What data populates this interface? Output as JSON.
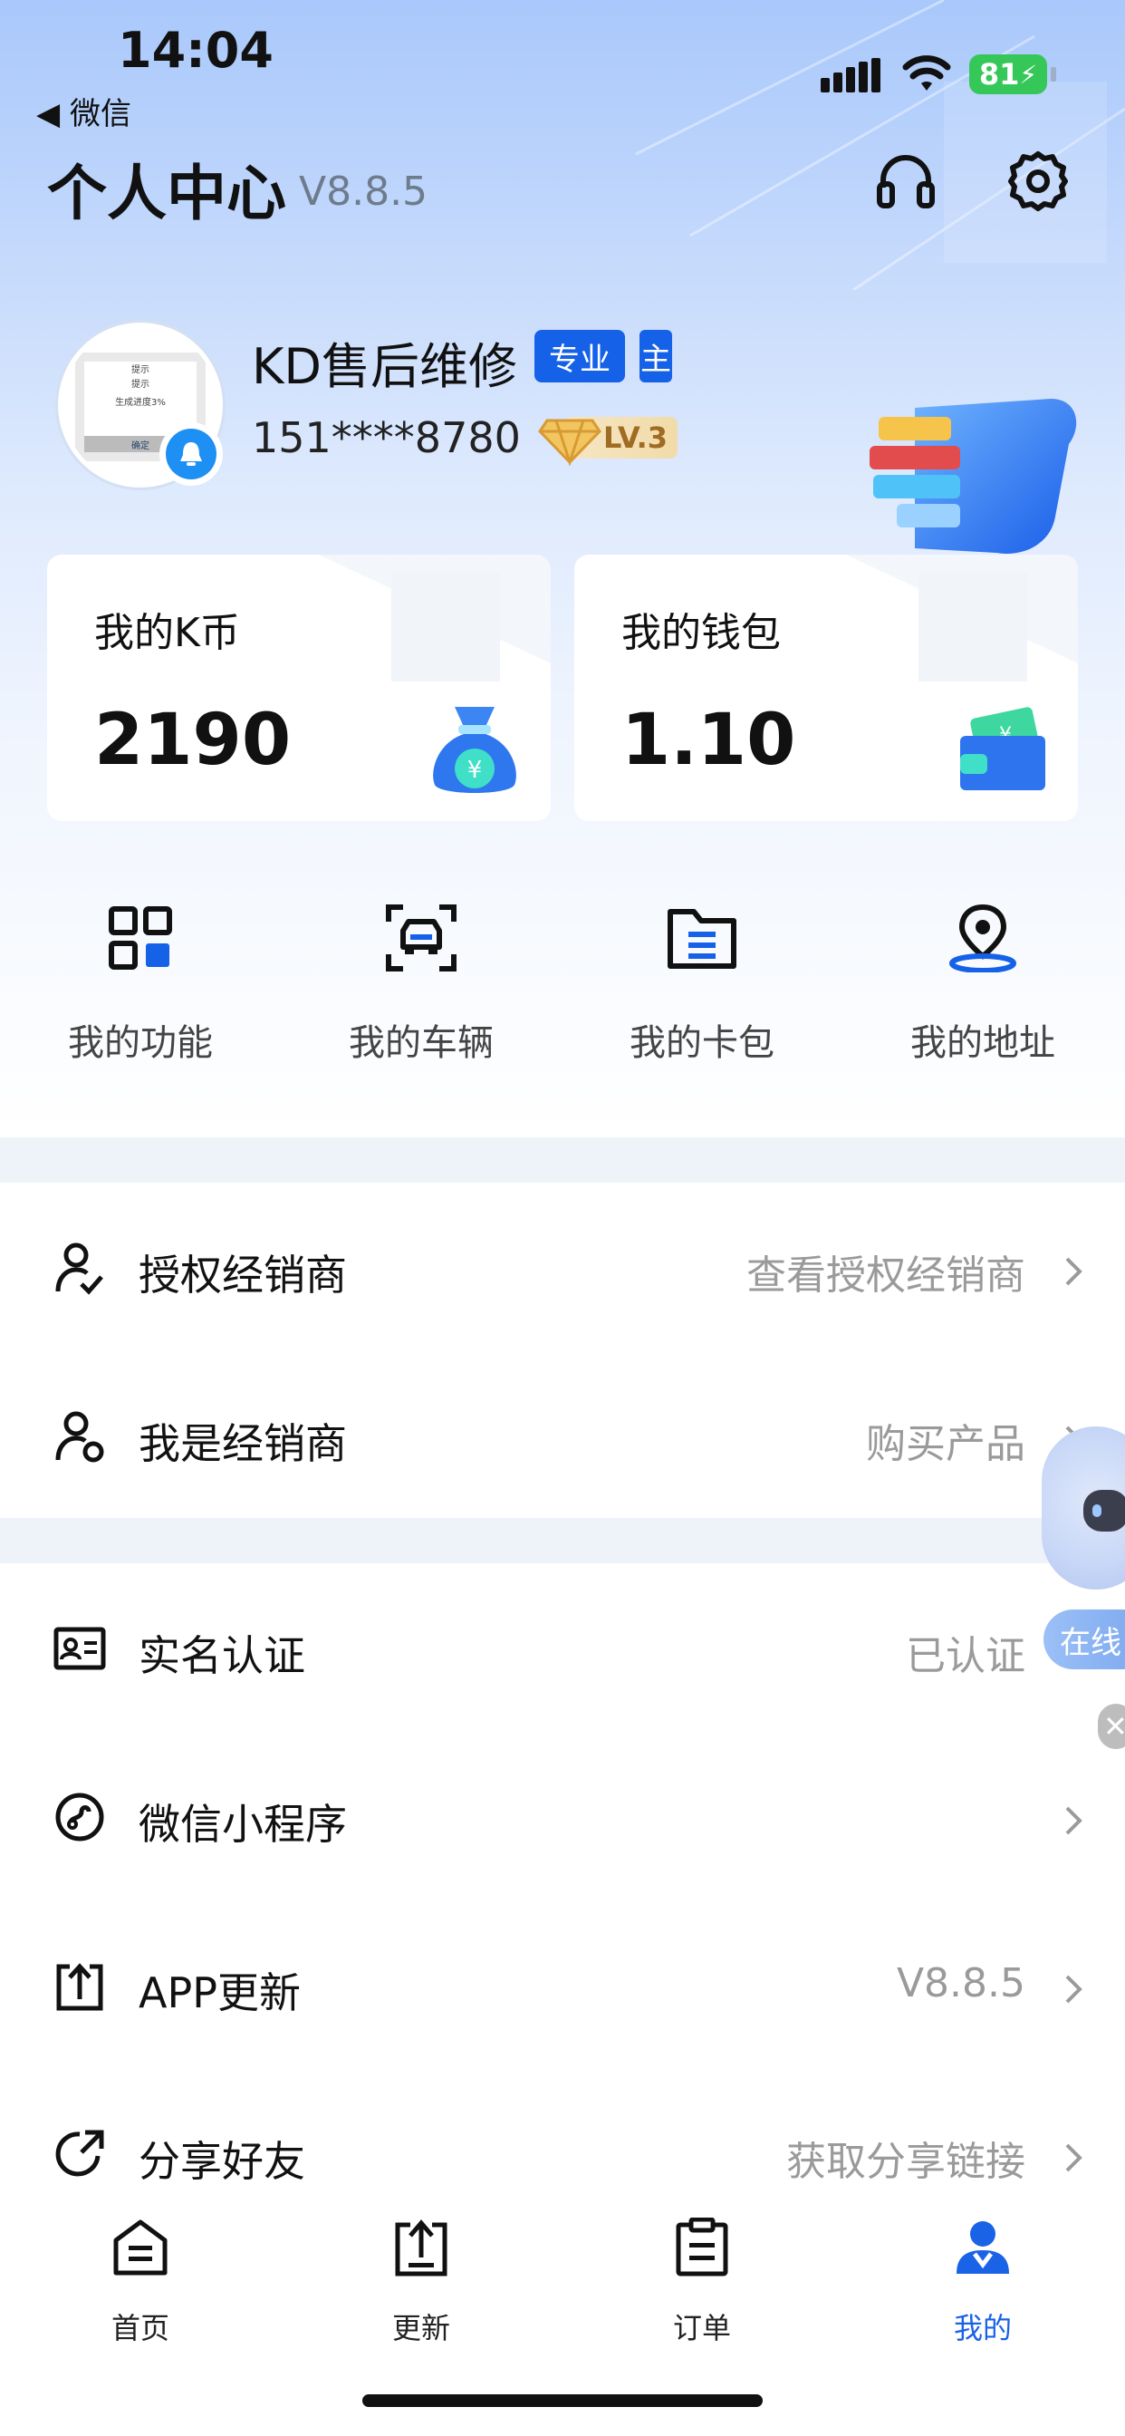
{
  "status_bar": {
    "time": "14:04",
    "back_app": "◀ 微信",
    "battery": "81"
  },
  "header": {
    "title": "个人中心",
    "version": "V8.8.5",
    "support_icon": "headset-icon",
    "settings_icon": "gear-icon"
  },
  "profile": {
    "name": "KD售后维修",
    "tag_pro": "专业",
    "tag_main": "主",
    "phone": "151****8780",
    "level": "LV.3"
  },
  "avatar_text": {
    "line1": "提示",
    "line2": "提示",
    "line3": "生成进度3%",
    "button": "确定"
  },
  "cards": [
    {
      "title": "我的K币",
      "value": "2190",
      "icon": "money-bag-icon"
    },
    {
      "title": "我的钱包",
      "value": "1.10",
      "icon": "wallet-icon"
    }
  ],
  "quick_actions": [
    {
      "label": "我的功能",
      "icon": "grid-icon"
    },
    {
      "label": "我的车辆",
      "icon": "car-scan-icon"
    },
    {
      "label": "我的卡包",
      "icon": "folder-icon"
    },
    {
      "label": "我的地址",
      "icon": "location-pin-icon"
    }
  ],
  "menu_group1": [
    {
      "label": "授权经销商",
      "value": "查看授权经销商",
      "icon": "user-check-icon"
    },
    {
      "label": "我是经销商",
      "value": "购买产品",
      "icon": "user-settings-icon"
    }
  ],
  "menu_group2": [
    {
      "label": "实名认证",
      "value": "已认证",
      "icon": "id-card-icon"
    },
    {
      "label": "微信小程序",
      "value": "",
      "icon": "mini-program-icon"
    },
    {
      "label": "APP更新",
      "value": "V8.8.5",
      "icon": "upload-icon"
    },
    {
      "label": "分享好友",
      "value": "获取分享链接",
      "icon": "share-icon"
    }
  ],
  "floating": {
    "online_label": "在线"
  },
  "tabs": [
    {
      "label": "首页",
      "icon": "home-icon",
      "active": false
    },
    {
      "label": "更新",
      "icon": "update-icon",
      "active": false
    },
    {
      "label": "订单",
      "icon": "order-icon",
      "active": false
    },
    {
      "label": "我的",
      "icon": "profile-icon",
      "active": true
    }
  ],
  "colors": {
    "accent": "#1561e8",
    "active_tab": "#1a62e6",
    "muted": "#9a9a9a"
  }
}
